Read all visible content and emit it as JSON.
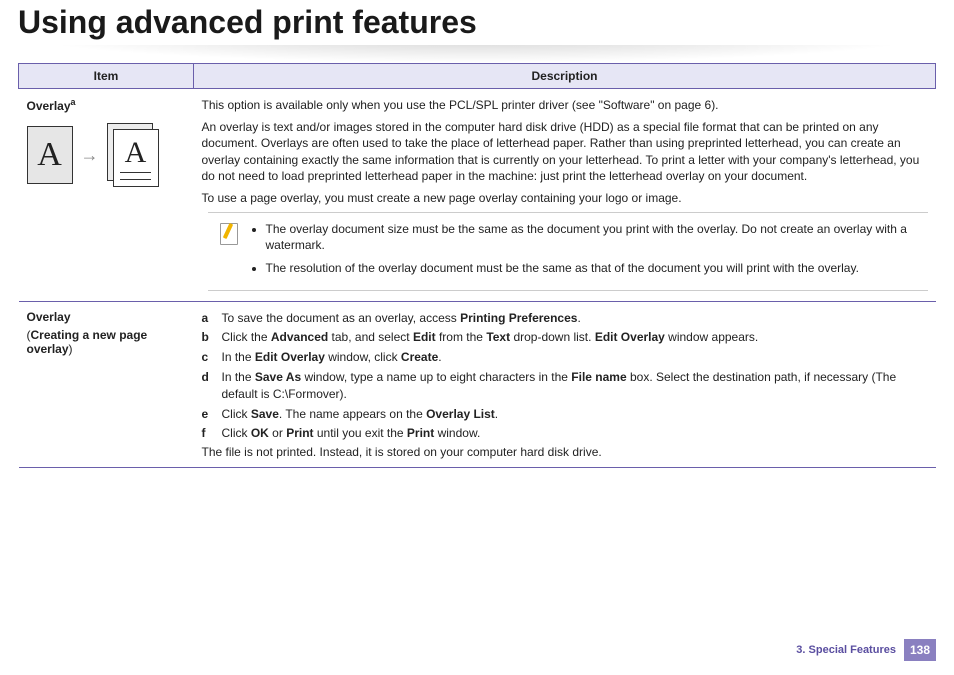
{
  "title": "Using advanced print features",
  "table": {
    "headers": {
      "item": "Item",
      "description": "Description"
    },
    "row1": {
      "label": "Overlay",
      "sup": "a",
      "p1": "This option is available only when you use the PCL/SPL printer driver (see \"Software\" on page 6).",
      "p2": "An overlay is text and/or images stored in the computer hard disk drive (HDD) as a special file format that can be printed on any document. Overlays are often used to take the place of letterhead paper. Rather than using preprinted letterhead, you can create an overlay containing exactly the same information that is currently on your letterhead. To print a letter with your company's letterhead, you do not need to load preprinted letterhead paper in the machine: just print the letterhead overlay on your document.",
      "p3": "To use a page overlay, you must create a new page overlay containing your logo or image.",
      "note1": "The overlay document size must be the same as the document you print with the overlay. Do not create an overlay with a watermark.",
      "note2": "The resolution of the overlay document must be the same as that of the document you will print with the overlay."
    },
    "row2": {
      "label1": "Overlay",
      "label2_open": "(",
      "label2_bold": "Creating a new page overlay",
      "label2_close": ")",
      "a_pre": "To save the document as an overlay, access ",
      "a_b": "Printing Preferences",
      "a_post": ".",
      "b_t1": "Click the ",
      "b_b1": "Advanced",
      "b_t2": " tab, and select ",
      "b_b2": "Edit",
      "b_t3": " from the ",
      "b_b3": "Text",
      "b_t4": " drop-down list. ",
      "b_b4": "Edit Overlay",
      "b_t5": " window appears.",
      "c_t1": "In the ",
      "c_b1": "Edit Overlay",
      "c_t2": " window, click ",
      "c_b2": "Create",
      "c_t3": ".",
      "d_t1": "In the ",
      "d_b1": "Save As",
      "d_t2": " window, type a name up to eight characters in the ",
      "d_b2": "File name",
      "d_t3": " box. Select the destination path, if necessary (The default is C:\\Formover).",
      "e_t1": "Click ",
      "e_b1": "Save",
      "e_t2": ". The name appears on the ",
      "e_b2": "Overlay List",
      "e_t3": ".",
      "f_t1": "Click ",
      "f_b1": "OK",
      "f_t2": " or ",
      "f_b2": "Print",
      "f_t3": " until you exit the ",
      "f_b3": "Print",
      "f_t4": " window.",
      "f_follow": "The file is not printed. Instead, it is stored on your computer hard disk drive."
    }
  },
  "letters": {
    "lbl_a": "a",
    "lbl_b": "b",
    "lbl_c": "c",
    "lbl_d": "d",
    "lbl_e": "e",
    "lbl_f": "f"
  },
  "graphic": {
    "A1": "A",
    "A2": "A"
  },
  "footer": {
    "chapter": "3.  Special Features",
    "page": "138"
  }
}
